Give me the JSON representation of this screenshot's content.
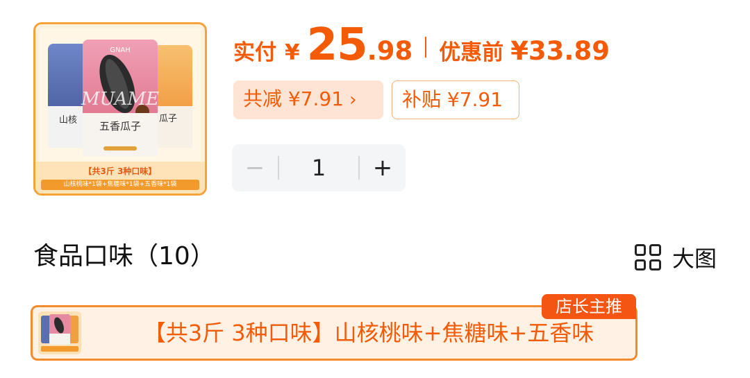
{
  "product": {
    "image_icon": "sunflower-seed-bags-image",
    "bag_brand": "MUAME",
    "bag_logo_text": "GNAH",
    "bag_front_name": "五香瓜子",
    "bag_left_name": "山核",
    "bag_right_name": "瓜子",
    "banner_title": "【共3斤 3种口味】",
    "banner_strip": "山核桃味*1袋+焦糖味*1袋+五香味*1袋"
  },
  "price": {
    "paid_label": "实付",
    "currency": "¥",
    "amount_int": "25",
    "amount_dec": ".98",
    "before_label": "优惠前",
    "before_amount": "¥33.89"
  },
  "discounts": {
    "total_text": "共减 ¥7.91",
    "chevron": "›",
    "subsidy_text": "补贴 ¥7.91"
  },
  "quantity": {
    "minus": "−",
    "value": "1",
    "plus": "+"
  },
  "section": {
    "title": "食品口味（10）",
    "view_label": "大图",
    "view_icon": "grid-icon"
  },
  "option": {
    "label": "【共3斤 3种口味】山核桃味+焦糖味+五香味",
    "tag": "店长主推",
    "thumb_banner": "【共3斤 3种口味】"
  },
  "colors": {
    "accent": "#f35b07",
    "border": "#f28b2c",
    "badge_bg": "#fde4d4",
    "option_bg": "#fff2e5",
    "tag_bg": "#f45512"
  }
}
